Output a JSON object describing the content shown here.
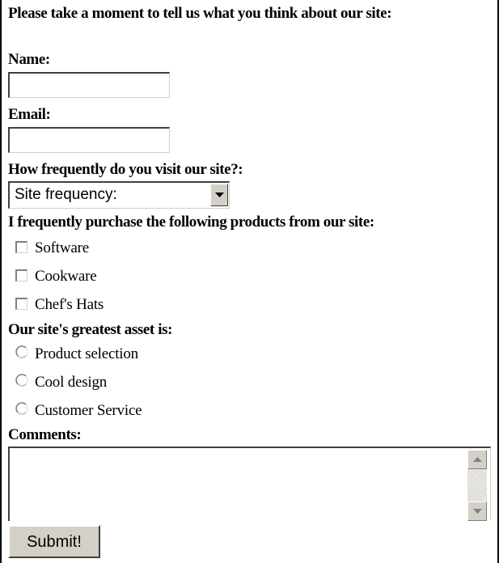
{
  "form": {
    "intro": "Please take a moment to tell us what you think about our site:",
    "name": {
      "label": "Name:",
      "value": ""
    },
    "email": {
      "label": "Email:",
      "value": ""
    },
    "frequency": {
      "label": "How frequently do you visit our site?:",
      "selected": "Site frequency:"
    },
    "products": {
      "label": "I frequently purchase the following products from our site:",
      "options": [
        {
          "label": "Software",
          "checked": false
        },
        {
          "label": "Cookware",
          "checked": false
        },
        {
          "label": "Chef's Hats",
          "checked": false
        }
      ]
    },
    "asset": {
      "label": "Our site's greatest asset is:",
      "options": [
        {
          "label": "Product selection",
          "selected": false
        },
        {
          "label": "Cool design",
          "selected": false
        },
        {
          "label": "Customer Service",
          "selected": false
        }
      ]
    },
    "comments": {
      "label": "Comments:",
      "value": ""
    },
    "submit_label": "Submit!"
  }
}
